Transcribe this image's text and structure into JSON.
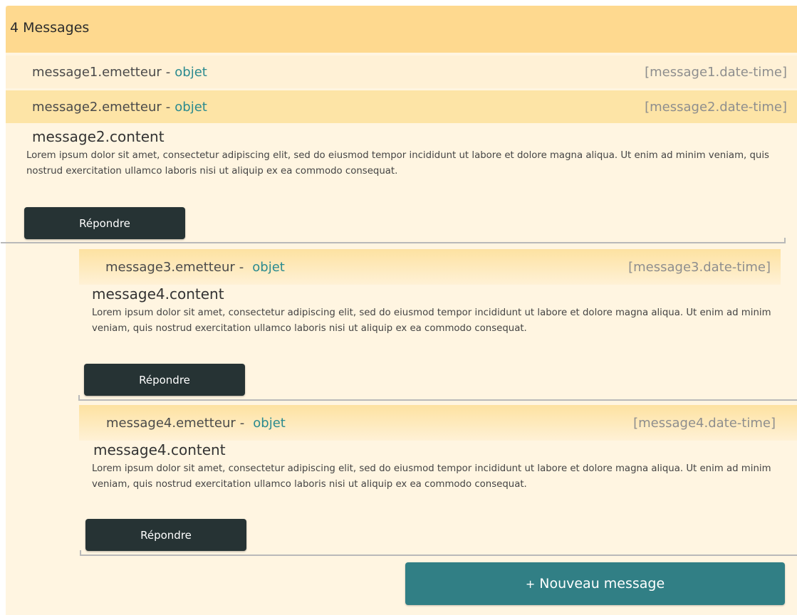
{
  "header": {
    "title": "4 Messages"
  },
  "messages": [
    {
      "sender": "message1.emetteur",
      "separator": "-",
      "subject": "objet",
      "datetime": "[message1.date-time]"
    },
    {
      "sender": "message2.emetteur",
      "separator": "-",
      "subject": "objet",
      "datetime": "[message2.date-time]",
      "content_title": "message2.content",
      "content_text": "Lorem ipsum dolor sit amet, consectetur adipiscing elit, sed do eiusmod tempor incididunt ut labore et dolore magna aliqua. Ut enim ad minim veniam, quis nostrud exercitation ullamco laboris nisi ut aliquip ex ea commodo consequat.",
      "reply_label": "Répondre"
    },
    {
      "sender": "message3.emetteur",
      "separator": "-",
      "subject": "objet",
      "datetime": "[message3.date-time]",
      "content_title": "message4.content",
      "content_text": "Lorem ipsum dolor sit amet, consectetur adipiscing elit, sed do eiusmod tempor incididunt ut labore et dolore magna aliqua. Ut enim ad minim veniam, quis nostrud exercitation ullamco laboris nisi ut aliquip ex ea commodo consequat.",
      "reply_label": "Répondre"
    },
    {
      "sender": "message4.emetteur",
      "separator": "-",
      "subject": "objet",
      "datetime": "[message4.date-time]",
      "content_title": "message4.content",
      "content_text": "Lorem ipsum dolor sit amet, consectetur adipiscing elit, sed do eiusmod tempor incididunt ut labore et dolore magna aliqua. Ut enim ad minim veniam, quis nostrud exercitation ullamco laboris nisi ut aliquip ex ea commodo consequat.",
      "reply_label": "Répondre"
    }
  ],
  "footer": {
    "new_message_icon": "+",
    "new_message_label": "Nouveau message"
  },
  "colors": {
    "header_bg": "#fed98f",
    "panel_bg": "#fff5e1",
    "subject": "#2a8a8f",
    "reply_button": "#263334",
    "new_message_button": "#317f85"
  }
}
